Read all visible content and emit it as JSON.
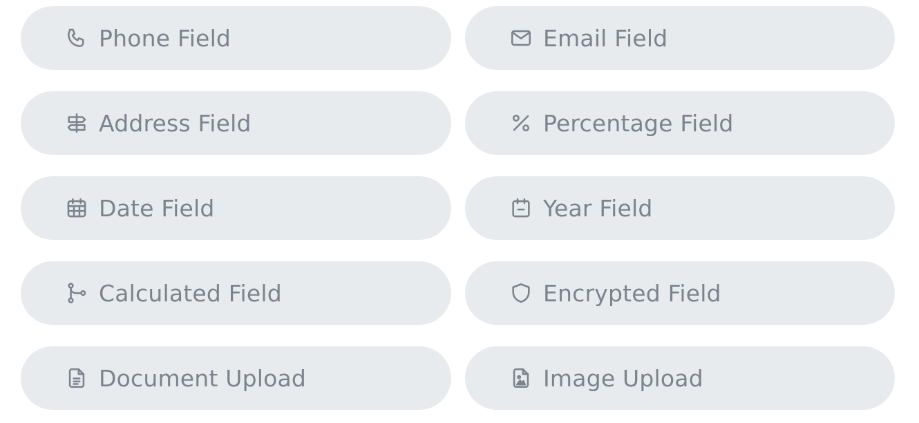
{
  "fields": [
    {
      "label": "Phone Field",
      "icon": "phone-icon"
    },
    {
      "label": "Email Field",
      "icon": "envelope-icon"
    },
    {
      "label": "Address Field",
      "icon": "signpost-icon"
    },
    {
      "label": "Percentage Field",
      "icon": "percent-icon"
    },
    {
      "label": "Date Field",
      "icon": "calendar-grid-icon"
    },
    {
      "label": "Year Field",
      "icon": "calendar-minus-icon"
    },
    {
      "label": "Calculated Field",
      "icon": "branch-icon"
    },
    {
      "label": "Encrypted Field",
      "icon": "shield-icon"
    },
    {
      "label": "Document Upload",
      "icon": "document-icon"
    },
    {
      "label": "Image Upload",
      "icon": "image-file-icon"
    }
  ],
  "colors": {
    "pill_background": "#e8ebee",
    "text": "#7b838d"
  }
}
